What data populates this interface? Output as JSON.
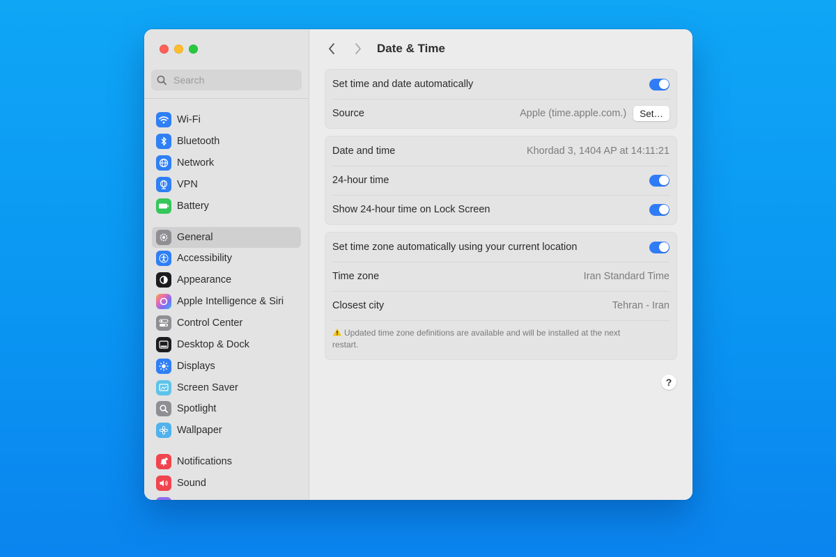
{
  "sidebar": {
    "search_placeholder": "Search",
    "items": [
      {
        "label": "Wi-Fi",
        "icon": "wifi-icon",
        "color": "#2f7ff5"
      },
      {
        "label": "Bluetooth",
        "icon": "bluetooth-icon",
        "color": "#2f7ff5"
      },
      {
        "label": "Network",
        "icon": "globe-icon",
        "color": "#2f7ff5"
      },
      {
        "label": "VPN",
        "icon": "vpn-globe-icon",
        "color": "#2f7ff5"
      },
      {
        "label": "Battery",
        "icon": "battery-icon",
        "color": "#34c759"
      },
      {
        "label": "General",
        "icon": "gear-icon",
        "color": "#8e8e93",
        "selected": true
      },
      {
        "label": "Accessibility",
        "icon": "accessibility-icon",
        "color": "#2f7ff5"
      },
      {
        "label": "Appearance",
        "icon": "appearance-icon",
        "color": "#1c1c1e"
      },
      {
        "label": "Apple Intelligence & Siri",
        "icon": "siri-icon",
        "color": "#e86ab5"
      },
      {
        "label": "Control Center",
        "icon": "control-center-icon",
        "color": "#8e8e93"
      },
      {
        "label": "Desktop & Dock",
        "icon": "dock-icon",
        "color": "#1c1c1e"
      },
      {
        "label": "Displays",
        "icon": "sun-icon",
        "color": "#2f7ff5"
      },
      {
        "label": "Screen Saver",
        "icon": "screen-saver-icon",
        "color": "#5ec3e8"
      },
      {
        "label": "Spotlight",
        "icon": "magnifier-icon",
        "color": "#8e8e93"
      },
      {
        "label": "Wallpaper",
        "icon": "flower-icon",
        "color": "#4fb2ec"
      },
      {
        "label": "Notifications",
        "icon": "bell-icon",
        "color": "#f0444e"
      },
      {
        "label": "Sound",
        "icon": "speaker-icon",
        "color": "#f0444e"
      }
    ]
  },
  "header": {
    "title": "Date & Time"
  },
  "groups": {
    "auto": {
      "set_auto_label": "Set time and date automatically",
      "set_auto_on": true,
      "source_label": "Source",
      "source_value": "Apple (time.apple.com.)",
      "set_button": "Set…"
    },
    "clock": {
      "date_time_label": "Date and time",
      "date_time_value": "Khordad 3, 1404 AP at 14:11:21",
      "hour24_label": "24-hour time",
      "hour24_on": true,
      "lock_label": "Show 24-hour time on Lock Screen",
      "lock_on": true
    },
    "timezone": {
      "auto_tz_label": "Set time zone automatically using your current location",
      "auto_tz_on": true,
      "tz_label": "Time zone",
      "tz_value": "Iran Standard Time",
      "city_label": "Closest city",
      "city_value": "Tehran - Iran",
      "note": "Updated time zone definitions are available and will be installed at the next restart."
    }
  },
  "help_label": "?",
  "colors": {
    "accent": "#2f7cf6",
    "desktop": "#0a96f2",
    "warning": "#f5c518"
  }
}
